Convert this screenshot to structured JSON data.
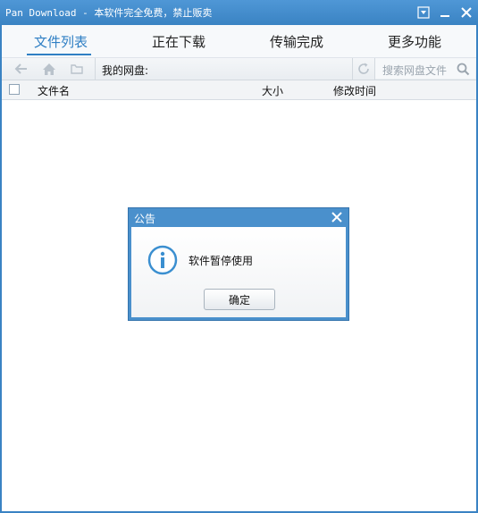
{
  "window": {
    "title": "Pan Download - 本软件完全免费，禁止贩卖"
  },
  "tabs": [
    {
      "label": "文件列表",
      "active": true
    },
    {
      "label": "正在下载",
      "active": false
    },
    {
      "label": "传输完成",
      "active": false
    },
    {
      "label": "更多功能",
      "active": false
    }
  ],
  "navbar": {
    "path_label": "我的网盘:",
    "search_placeholder": "搜索网盘文件",
    "icons": [
      "back-arrow-icon",
      "home-icon",
      "folder-icon",
      "refresh-icon",
      "search-icon"
    ]
  },
  "table": {
    "columns": [
      "文件名",
      "大小",
      "修改时间"
    ]
  },
  "dialog": {
    "title": "公告",
    "message": "软件暂停使用",
    "ok_label": "确定",
    "icon": "info-icon"
  },
  "colors": {
    "frame": "#3a83c3",
    "accent": "#2f7fc4"
  }
}
